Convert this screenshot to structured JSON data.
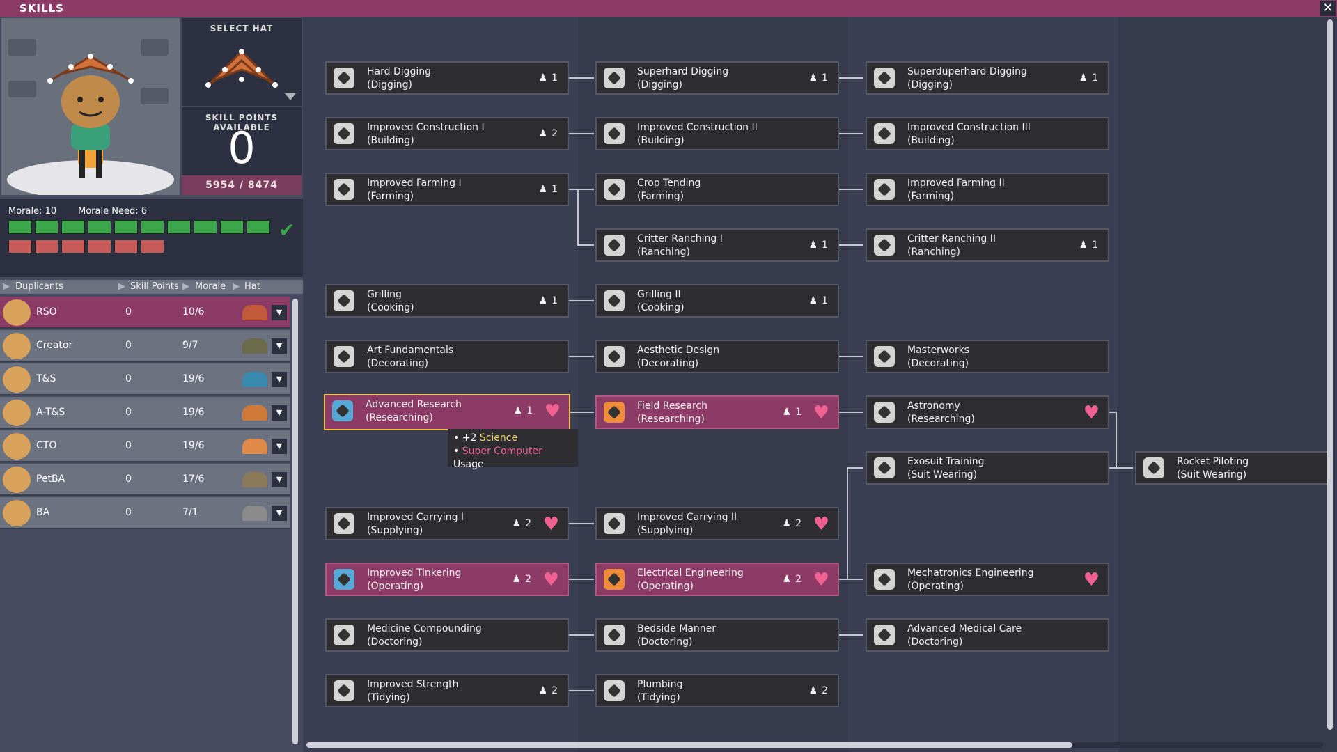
{
  "window": {
    "title": "SKILLS",
    "close_icon": "close-icon"
  },
  "duplicant": {
    "select_hat_label": "SELECT HAT",
    "skill_points_label": "SKILL POINTS AVAILABLE",
    "skill_points": "0",
    "xp": "5954 / 8474",
    "morale_label": "Morale: 10",
    "morale_need_label": "Morale Need: 6",
    "morale_value": 10,
    "morale_need_value": 6
  },
  "list_header": {
    "duplicants": "Duplicants",
    "skill_points": "Skill Points",
    "morale": "Morale",
    "hat": "Hat"
  },
  "duplicants": [
    {
      "name": "RSO",
      "skill_points": "0",
      "morale": "10/6",
      "hat_color": "#c05a3a",
      "selected": true
    },
    {
      "name": "Creator",
      "skill_points": "0",
      "morale": "9/7",
      "hat_color": "#6b6a4a"
    },
    {
      "name": "T&S",
      "skill_points": "0",
      "morale": "19/6",
      "hat_color": "#3a8ab0"
    },
    {
      "name": "A-T&S",
      "skill_points": "0",
      "morale": "19/6",
      "hat_color": "#d07a3a"
    },
    {
      "name": "CTO",
      "skill_points": "0",
      "morale": "19/6",
      "hat_color": "#e08a4a"
    },
    {
      "name": "PetBA",
      "skill_points": "0",
      "morale": "17/6",
      "hat_color": "#8a7a5a"
    },
    {
      "name": "BA",
      "skill_points": "0",
      "morale": "7/1",
      "hat_color": "#8a8a8a"
    }
  ],
  "skills": {
    "hard_digging": {
      "name": "Hard Digging",
      "group": "(Digging)",
      "count": "1"
    },
    "superhard_digging": {
      "name": "Superhard Digging",
      "group": "(Digging)",
      "count": "1"
    },
    "superduperhard_digging": {
      "name": "Superduperhard Digging",
      "group": "(Digging)",
      "count": "1"
    },
    "improved_construction_1": {
      "name": "Improved Construction I",
      "group": "(Building)",
      "count": "2"
    },
    "improved_construction_2": {
      "name": "Improved Construction II",
      "group": "(Building)"
    },
    "improved_construction_3": {
      "name": "Improved Construction III",
      "group": "(Building)"
    },
    "improved_farming_1": {
      "name": "Improved Farming I",
      "group": "(Farming)",
      "count": "1"
    },
    "crop_tending": {
      "name": "Crop Tending",
      "group": "(Farming)"
    },
    "improved_farming_2": {
      "name": "Improved Farming II",
      "group": "(Farming)"
    },
    "critter_ranching_1": {
      "name": "Critter Ranching I",
      "group": "(Ranching)",
      "count": "1"
    },
    "critter_ranching_2": {
      "name": "Critter Ranching II",
      "group": "(Ranching)",
      "count": "1"
    },
    "grilling": {
      "name": "Grilling",
      "group": "(Cooking)",
      "count": "1"
    },
    "grilling_2": {
      "name": "Grilling II",
      "group": "(Cooking)",
      "count": "1"
    },
    "art_fundamentals": {
      "name": "Art Fundamentals",
      "group": "(Decorating)"
    },
    "aesthetic_design": {
      "name": "Aesthetic Design",
      "group": "(Decorating)"
    },
    "masterworks": {
      "name": "Masterworks",
      "group": "(Decorating)"
    },
    "advanced_research": {
      "name": "Advanced Research",
      "group": "(Researching)",
      "count": "1"
    },
    "field_research": {
      "name": "Field Research",
      "group": "(Researching)",
      "count": "1"
    },
    "astronomy": {
      "name": "Astronomy",
      "group": "(Researching)"
    },
    "exosuit_training": {
      "name": "Exosuit Training",
      "group": "(Suit Wearing)"
    },
    "rocket_piloting": {
      "name": "Rocket Piloting",
      "group": "(Suit Wearing)"
    },
    "improved_carrying_1": {
      "name": "Improved Carrying I",
      "group": "(Supplying)",
      "count": "2"
    },
    "improved_carrying_2": {
      "name": "Improved Carrying II",
      "group": "(Supplying)",
      "count": "2"
    },
    "improved_tinkering": {
      "name": "Improved Tinkering",
      "group": "(Operating)",
      "count": "2"
    },
    "electrical_engineering": {
      "name": "Electrical Engineering",
      "group": "(Operating)",
      "count": "2"
    },
    "mechatronics": {
      "name": "Mechatronics Engineering",
      "group": "(Operating)"
    },
    "medicine_compounding": {
      "name": "Medicine Compounding",
      "group": "(Doctoring)"
    },
    "bedside_manner": {
      "name": "Bedside Manner",
      "group": "(Doctoring)"
    },
    "advanced_medical_care": {
      "name": "Advanced Medical Care",
      "group": "(Doctoring)"
    },
    "improved_strength": {
      "name": "Improved Strength",
      "group": "(Tidying)",
      "count": "2"
    },
    "plumbing": {
      "name": "Plumbing",
      "group": "(Tidying)",
      "count": "2"
    }
  },
  "tooltip": {
    "line1_prefix": "+2",
    "line1_value": "Science",
    "line2_value": "Super Computer",
    "line2_suffix": "Usage"
  },
  "colors": {
    "accent": "#8c3b67",
    "heart": "#f06191",
    "highlight": "#f2c24a"
  }
}
